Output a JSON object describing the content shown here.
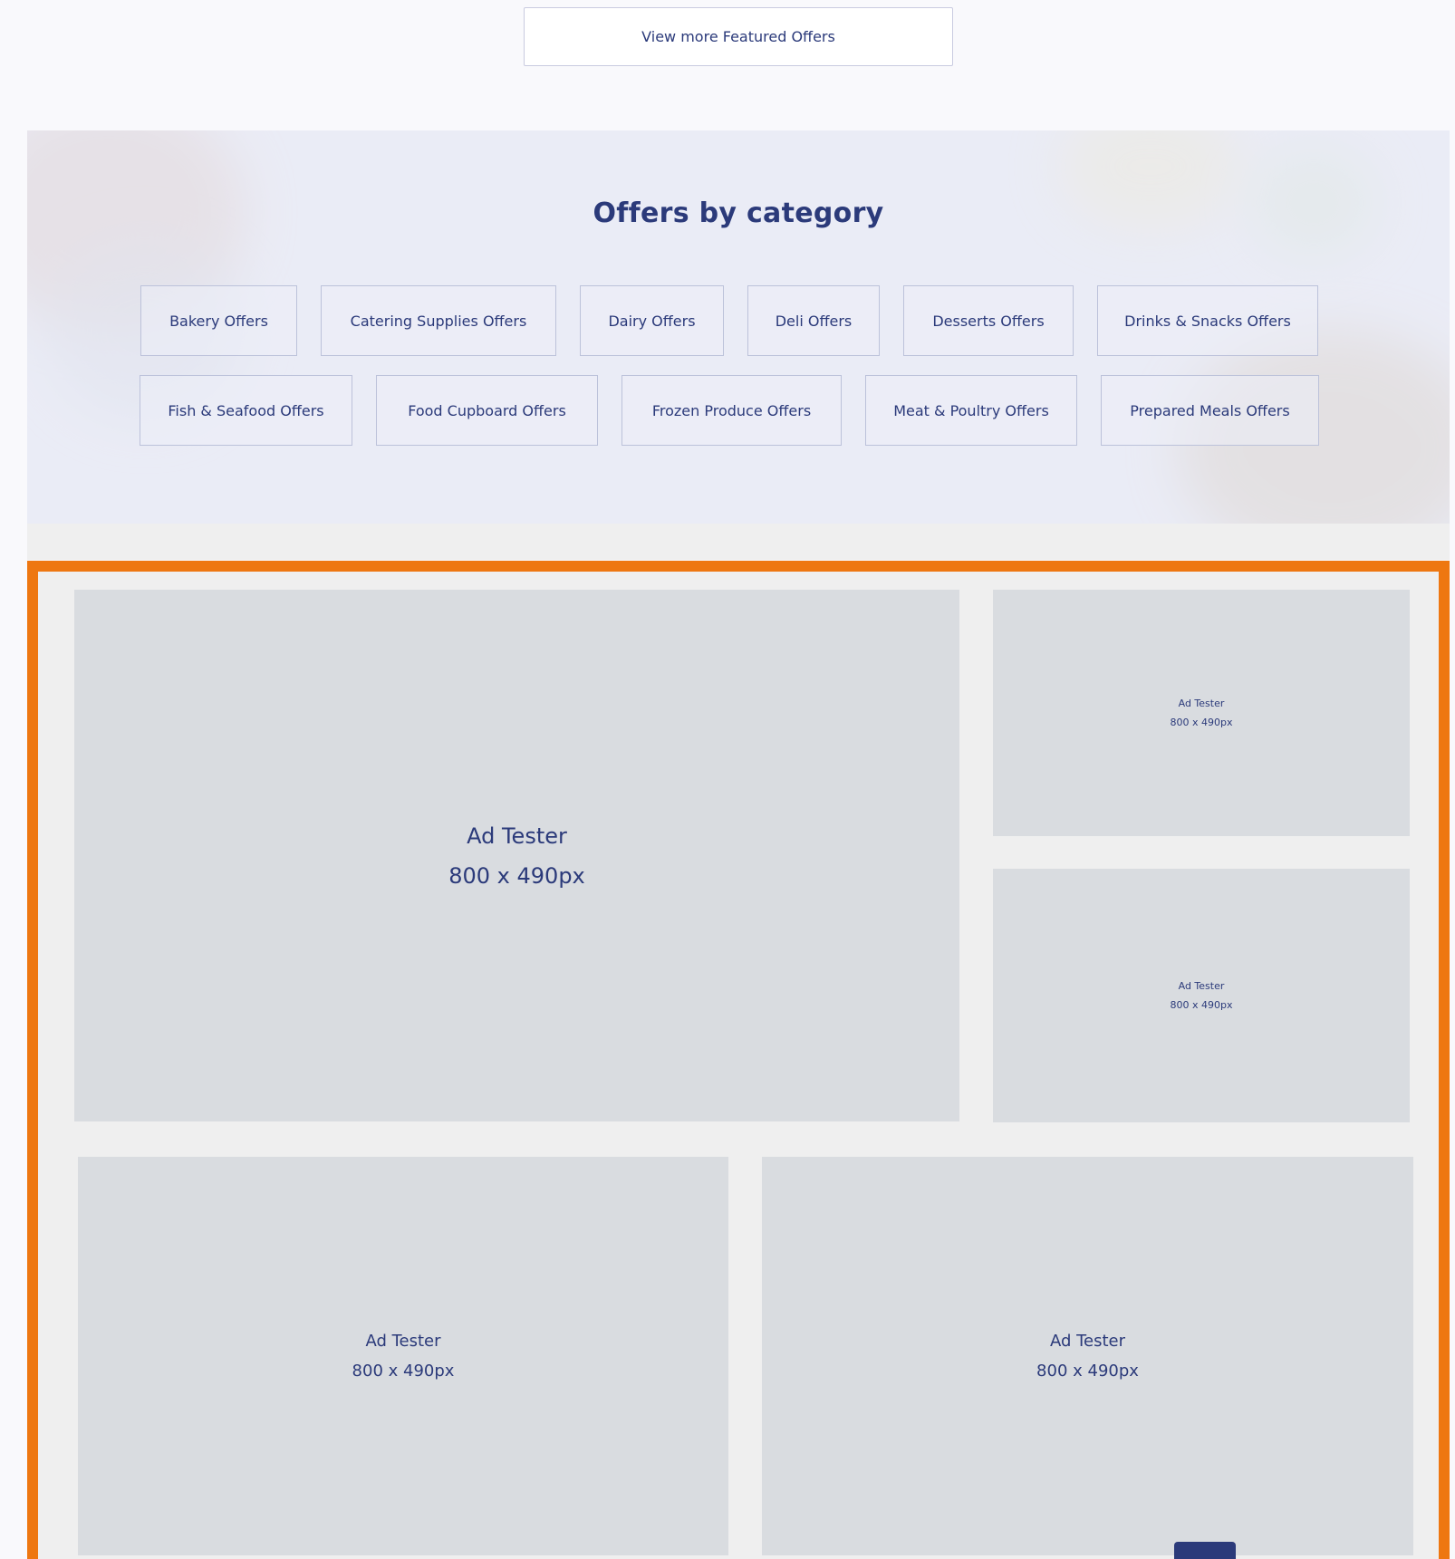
{
  "featured": {
    "view_more_label": "View more Featured Offers"
  },
  "categories": {
    "title": "Offers by category",
    "row1": [
      "Bakery Offers",
      "Catering Supplies Offers",
      "Dairy Offers",
      "Deli Offers",
      "Desserts Offers",
      "Drinks & Snacks Offers"
    ],
    "row2": [
      "Fish & Seafood Offers",
      "Food Cupboard Offers",
      "Frozen Produce Offers",
      "Meat & Poultry Offers",
      "Prepared Meals Offers"
    ]
  },
  "ads": [
    {
      "title": "Ad Tester",
      "size": "800 x 490px"
    },
    {
      "title": "Ad Tester",
      "size": "800 x 490px"
    },
    {
      "title": "Ad Tester",
      "size": "800 x 490px"
    },
    {
      "title": "Ad Tester",
      "size": "800 x 490px"
    },
    {
      "title": "Ad Tester",
      "size": "800 x 490px"
    }
  ],
  "colors": {
    "accent": "#ee7711",
    "brand": "#2b3a7a",
    "ad_placeholder": "#d9dce0"
  },
  "icons": {
    "scroll_to_top": "scroll-top-icon"
  }
}
